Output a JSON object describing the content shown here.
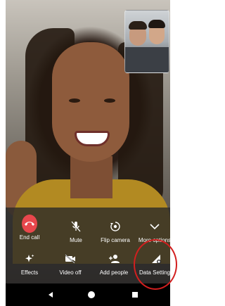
{
  "controls": {
    "row1": [
      {
        "id": "end-call",
        "label": "End call",
        "icon": "end-call-icon"
      },
      {
        "id": "mute",
        "label": "Mute",
        "icon": "mic-off-icon"
      },
      {
        "id": "flip-camera",
        "label": "Flip camera",
        "icon": "flip-camera-icon"
      },
      {
        "id": "more-options",
        "label": "More options",
        "icon": "chevron-down-icon"
      }
    ],
    "row2": [
      {
        "id": "effects",
        "label": "Effects",
        "icon": "sparkle-icon"
      },
      {
        "id": "video-off",
        "label": "Video off",
        "icon": "video-off-icon"
      },
      {
        "id": "add-people",
        "label": "Add people",
        "icon": "add-person-icon"
      },
      {
        "id": "data-settings",
        "label": "Data Settings",
        "icon": "data-settings-icon"
      }
    ]
  },
  "colors": {
    "end_call": "#e8474c",
    "annotation": "#d21f1f",
    "panel": "rgba(40,40,40,0.78)"
  },
  "nav": [
    "back-icon",
    "home-icon",
    "recents-icon"
  ]
}
